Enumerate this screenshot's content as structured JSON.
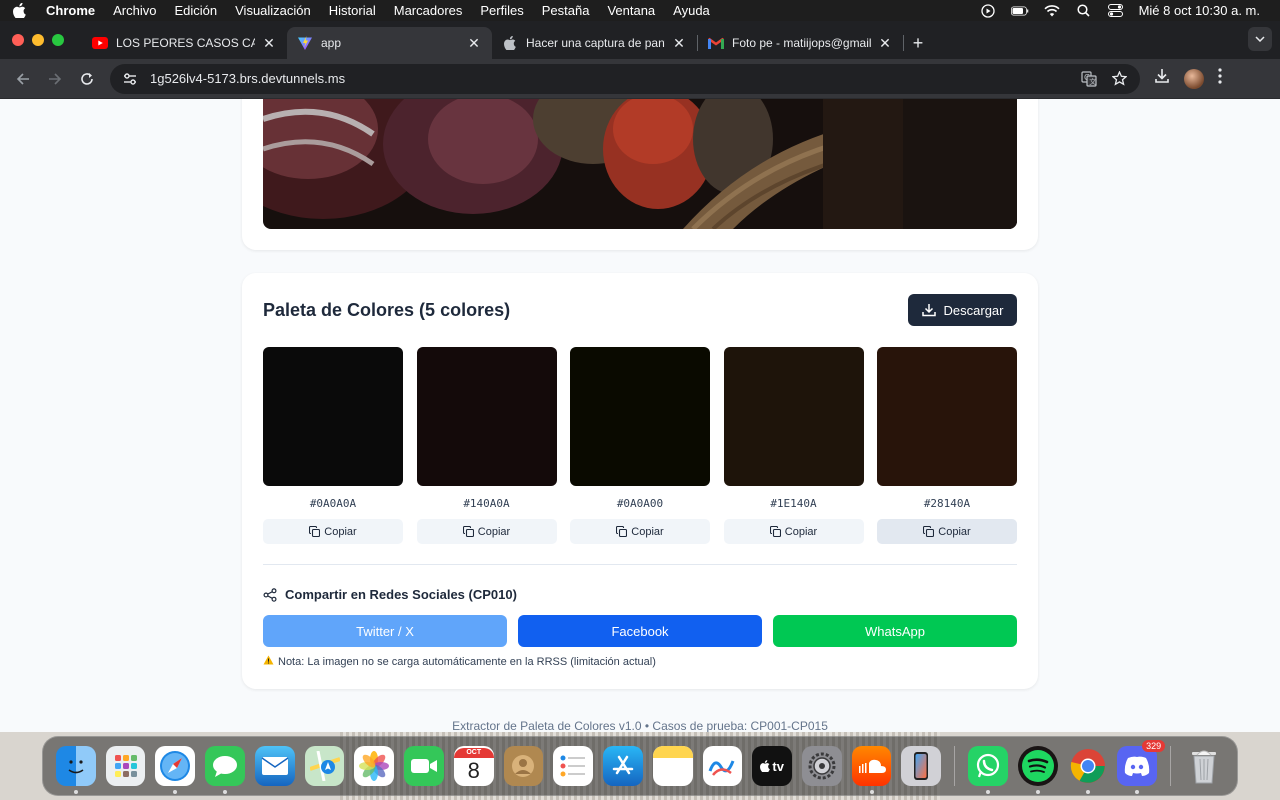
{
  "menubar": {
    "app": "Chrome",
    "items": [
      "Archivo",
      "Edición",
      "Visualización",
      "Historial",
      "Marcadores",
      "Perfiles",
      "Pestaña",
      "Ventana",
      "Ayuda"
    ],
    "datetime": "Mié 8 oct 10:30 a. m."
  },
  "tabs": [
    {
      "title": "LOS PEORES CASOS CAPTAD",
      "favicon": "youtube-icon",
      "active": false
    },
    {
      "title": "app",
      "favicon": "vite-icon",
      "active": true
    },
    {
      "title": "Hacer una captura de pantalla",
      "favicon": "apple-icon",
      "active": false
    },
    {
      "title": "Foto pe - matiijops@gmail.com",
      "favicon": "gmail-icon",
      "active": false
    }
  ],
  "toolbar": {
    "url": "1g526lv4-5173.brs.devtunnels.ms"
  },
  "palette": {
    "title": "Paleta de Colores (5 colores)",
    "download_label": "Descargar",
    "copy_label": "Copiar",
    "colors": [
      {
        "hex": "#0A0A0A"
      },
      {
        "hex": "#140A0A"
      },
      {
        "hex": "#0A0A00"
      },
      {
        "hex": "#1E140A"
      },
      {
        "hex": "#28140A"
      }
    ]
  },
  "share": {
    "title": "Compartir en Redes Sociales (CP010)",
    "twitter_label": "Twitter / X",
    "facebook_label": "Facebook",
    "whatsapp_label": "WhatsApp",
    "note": "Nota: La imagen no se carga automáticamente en la RRSS (limitación actual)",
    "colors": {
      "twitter": "#60a5fa",
      "facebook": "#1160f0",
      "whatsapp": "#00c853"
    }
  },
  "footer": "Extractor de Paleta de Colores v1.0 • Casos de prueba: CP001-CP015",
  "dock": {
    "calendar_month": "OCT",
    "calendar_day": "8",
    "tv_label": "tv",
    "discord_badge": "329"
  }
}
